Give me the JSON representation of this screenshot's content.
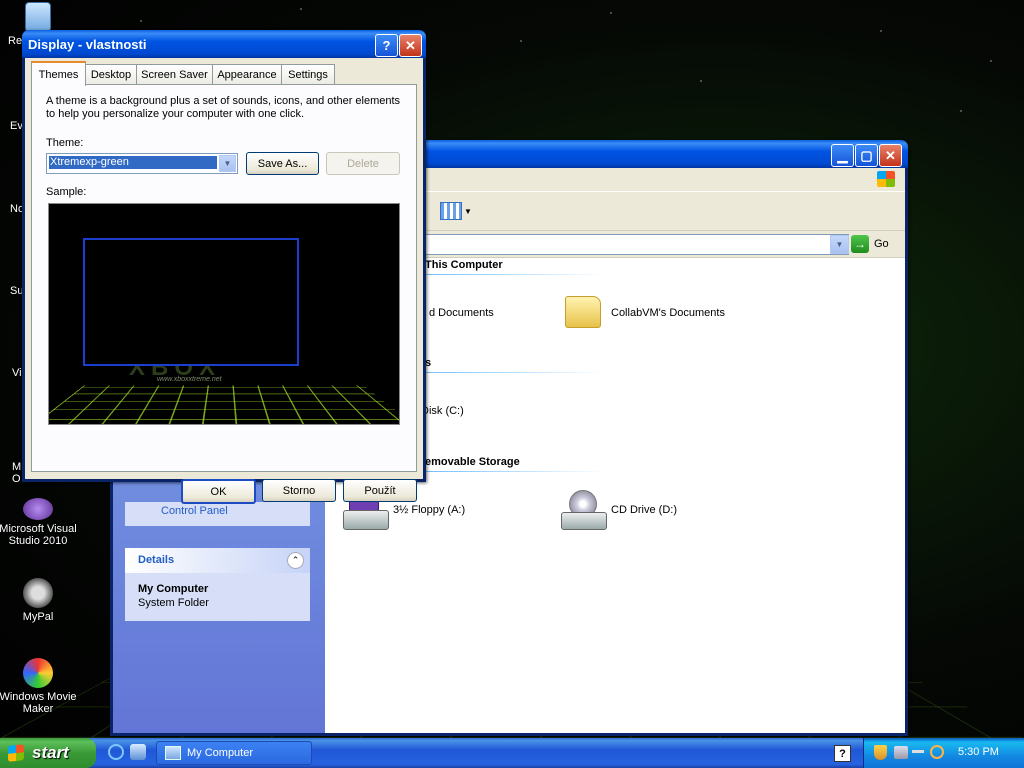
{
  "desktop": {
    "icons": [
      {
        "label": "Re",
        "name": "recycle-bin-icon"
      },
      {
        "label": "Ev"
      },
      {
        "label": "No"
      },
      {
        "label": "Su"
      },
      {
        "label": "Vi"
      },
      {
        "label": "M\nO"
      },
      {
        "label": "Microsoft Visual Studio 2010"
      },
      {
        "label": "MyPal"
      },
      {
        "label": "Windows Movie Maker"
      }
    ]
  },
  "display_dialog": {
    "title": "Display - vlastnosti",
    "tabs": [
      "Themes",
      "Desktop",
      "Screen Saver",
      "Appearance",
      "Settings"
    ],
    "description": "A theme is a background plus a set of sounds, icons, and other elements to help you personalize your computer with one click.",
    "theme_label": "Theme:",
    "theme_value": "Xtremexp-green",
    "save_as": "Save As...",
    "delete": "Delete",
    "sample_label": "Sample:",
    "preview_url": "www.xboxxtreme.net",
    "preview_logo": "XBOX",
    "ok": "OK",
    "cancel": "Storno",
    "apply": "Použít"
  },
  "my_computer": {
    "go_label": "Go",
    "sections": {
      "this_computer": "This Computer",
      "hard_disks": "s",
      "removable": "emovable Storage"
    },
    "items": {
      "shared_docs": "d Documents",
      "user_docs": "CollabVM's Documents",
      "local_disk": "Disk (C:)",
      "floppy": "3½ Floppy (A:)",
      "cd": "CD Drive (D:)"
    },
    "sidebar": {
      "control_panel": "Control Panel",
      "details_title": "Details",
      "details_name": "My Computer",
      "details_type": "System Folder"
    }
  },
  "taskbar": {
    "start": "start",
    "task": "My Computer",
    "time": "5:30 PM"
  }
}
